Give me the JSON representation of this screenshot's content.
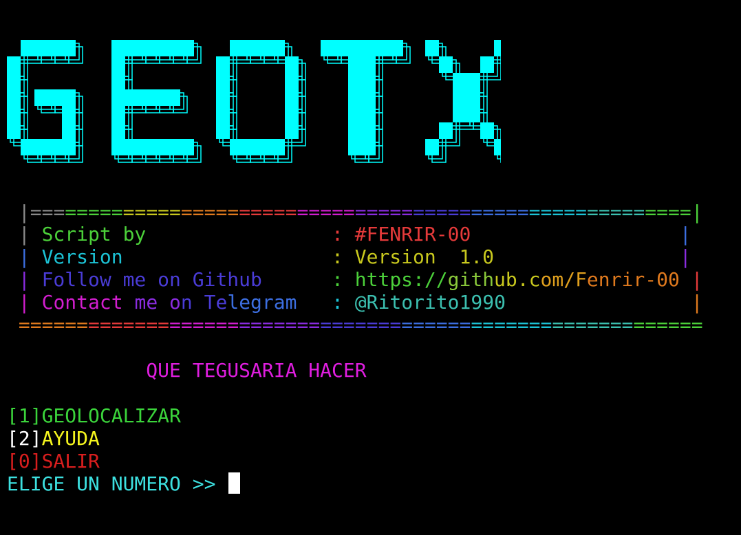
{
  "colors": {
    "background": "#000000",
    "banner_cyan": "#00ffff",
    "gray": "#8a8a8a",
    "green": "#4cd13a",
    "red": "#e53a3a",
    "cyan": "#1cc3d6",
    "yellow": "#c8c81e",
    "blue": "#4a3cd6",
    "purple": "#8a2ce0",
    "magenta": "#d21ecf",
    "orange": "#e07a1e",
    "light_blue": "#3c6ee0",
    "teal": "#3cc0b0",
    "menu_green": "#3bd43b",
    "menu_yellow": "#f5f51e",
    "menu_red": "#d81e1e",
    "prompt_cyan": "#3de0e0",
    "title_magenta": "#e01ee0",
    "cursor": "#ffffff"
  },
  "banner": {
    "text": "GEOTX"
  },
  "info_box": {
    "top_border": " |=========================================================|",
    "rows": [
      {
        "left_bar": " |",
        "label": " Script by               ",
        "sep": " : ",
        "value": "#FENRIR-00",
        "pad": "                  ",
        "right_bar": "|"
      },
      {
        "left_bar": " |",
        "label": " Version                 ",
        "sep": " : ",
        "value": "Version  1.0",
        "pad": "                ",
        "right_bar": "|"
      },
      {
        "left_bar": " |",
        "label": " Follow me on Github     ",
        "sep": " : ",
        "value": "https://github.com/Fenrir-00",
        "pad": " ",
        "right_bar": "|"
      },
      {
        "left_bar": " |",
        "label": " Contact me on Telegram  ",
        "sep": " : ",
        "value": "@Ritorito1990",
        "pad": "                ",
        "right_bar": "|"
      }
    ],
    "bottom_border": " ==========================================================="
  },
  "title": "            QUE TEGUSARIA HACER",
  "menu": [
    {
      "key": "[1]",
      "label": "GEOLOCALIZAR"
    },
    {
      "key": "[2]",
      "label": "AYUDA"
    },
    {
      "key": "[0]",
      "label": "SALIR"
    }
  ],
  "prompt": {
    "text": "ELIGE UN NUMERO >> "
  }
}
